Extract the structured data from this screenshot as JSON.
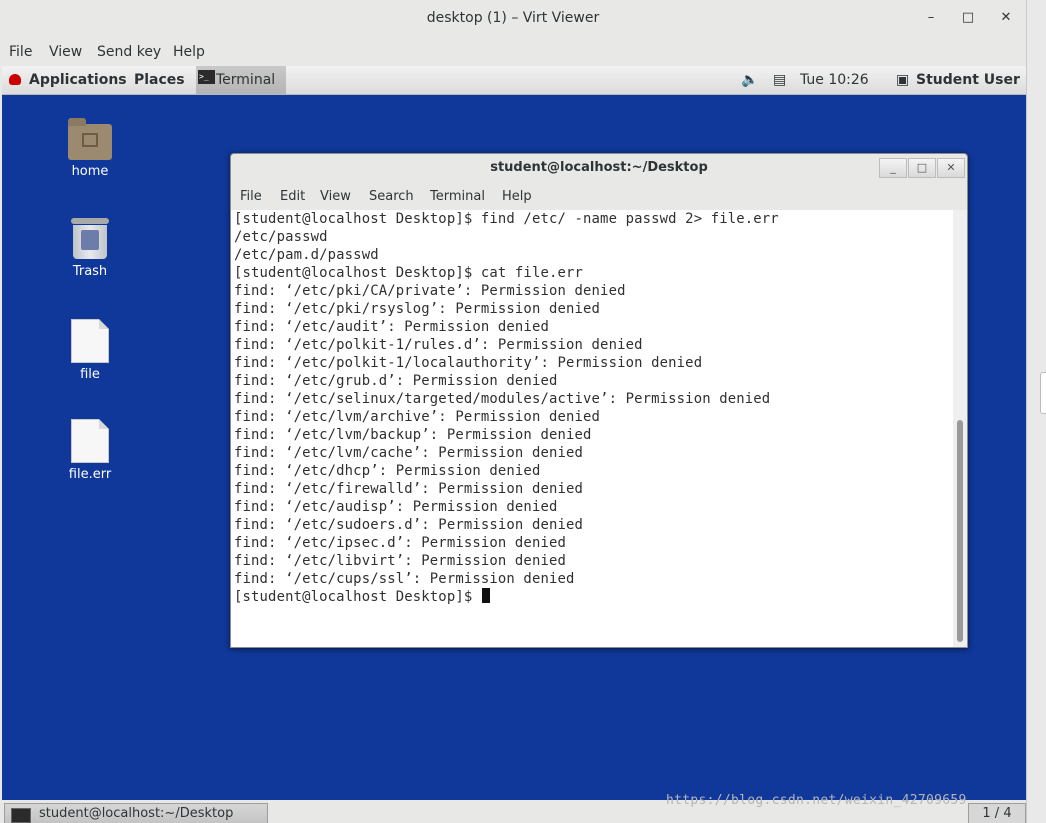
{
  "window": {
    "title": "desktop (1) – Virt Viewer",
    "controls": {
      "minimize": "–",
      "maximize": "□",
      "close": "✕"
    },
    "menu": [
      "File",
      "View",
      "Send key",
      "Help"
    ]
  },
  "topbar": {
    "applications": "Applications",
    "places": "Places",
    "task": "Terminal",
    "clock": "Tue 10:26",
    "user": "Student User",
    "icons": [
      "redhat-logo-icon",
      "volume-icon",
      "network-icon",
      "user-icon"
    ]
  },
  "desktop_icons": [
    {
      "label": "home",
      "icon": "home-folder-icon"
    },
    {
      "label": "Trash",
      "icon": "trash-icon"
    },
    {
      "label": "file",
      "icon": "document-icon"
    },
    {
      "label": "file.err",
      "icon": "document-icon"
    }
  ],
  "terminal": {
    "title": "student@localhost:~/Desktop",
    "menu": [
      "File",
      "Edit",
      "View",
      "Search",
      "Terminal",
      "Help"
    ],
    "lines": [
      "[student@localhost Desktop]$ find /etc/ -name passwd 2> file.err",
      "/etc/passwd",
      "/etc/pam.d/passwd",
      "[student@localhost Desktop]$ cat file.err",
      "find: ‘/etc/pki/CA/private’: Permission denied",
      "find: ‘/etc/pki/rsyslog’: Permission denied",
      "find: ‘/etc/audit’: Permission denied",
      "find: ‘/etc/polkit-1/rules.d’: Permission denied",
      "find: ‘/etc/polkit-1/localauthority’: Permission denied",
      "find: ‘/etc/grub.d’: Permission denied",
      "find: ‘/etc/selinux/targeted/modules/active’: Permission denied",
      "find: ‘/etc/lvm/archive’: Permission denied",
      "find: ‘/etc/lvm/backup’: Permission denied",
      "find: ‘/etc/lvm/cache’: Permission denied",
      "find: ‘/etc/dhcp’: Permission denied",
      "find: ‘/etc/firewalld’: Permission denied",
      "find: ‘/etc/audisp’: Permission denied",
      "find: ‘/etc/sudoers.d’: Permission denied",
      "find: ‘/etc/ipsec.d’: Permission denied",
      "find: ‘/etc/libvirt’: Permission denied",
      "find: ‘/etc/cups/ssl’: Permission denied"
    ],
    "prompt": "[student@localhost Desktop]$ "
  },
  "bottombar": {
    "task": "student@localhost:~/Desktop",
    "pager": "1 / 4"
  },
  "watermark": "https://blog.csdn.net/weixin_42709659",
  "colors": {
    "desktop": "#10389a",
    "panel": "#e8e8e7"
  }
}
